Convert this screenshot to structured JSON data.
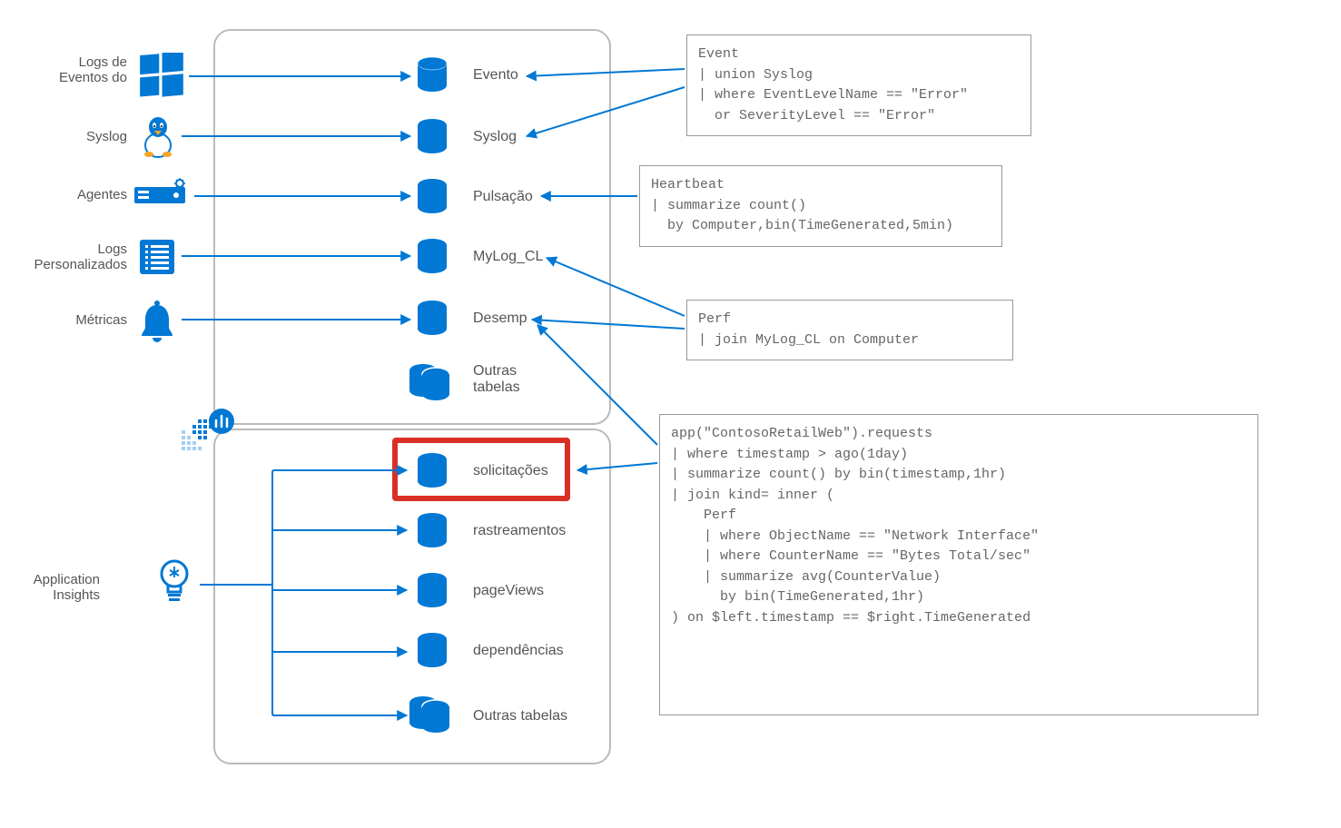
{
  "sources": [
    {
      "label": "Logs de\nEventos do"
    },
    {
      "label": "Syslog"
    },
    {
      "label": "Agentes"
    },
    {
      "label": "Logs\nPersonalizados"
    },
    {
      "label": "Métricas"
    },
    {
      "label": "Application\nInsights"
    }
  ],
  "tables_top": [
    {
      "label": "Evento"
    },
    {
      "label": "Syslog"
    },
    {
      "label": "Pulsação"
    },
    {
      "label": "MyLog_CL"
    },
    {
      "label": "Desemp"
    },
    {
      "label": "Outras\ntabelas"
    }
  ],
  "tables_bottom": [
    {
      "label": "solicitações"
    },
    {
      "label": "rastreamentos"
    },
    {
      "label": "pageViews"
    },
    {
      "label": "dependências"
    },
    {
      "label": "Outras tabelas"
    }
  ],
  "queries": {
    "q1": "Event\n| union Syslog\n| where EventLevelName == \"Error\"\n  or SeverityLevel == \"Error\"",
    "q2": "Heartbeat\n| summarize count()\n  by Computer,bin(TimeGenerated,5min)",
    "q3": "Perf\n| join MyLog_CL on Computer",
    "q4": "app(\"ContosoRetailWeb\").requests\n| where timestamp > ago(1day)\n| summarize count() by bin(timestamp,1hr)\n| join kind= inner (\n    Perf\n    | where ObjectName == \"Network Interface\"\n    | where CounterName == \"Bytes Total/sec\"\n    | summarize avg(CounterValue)\n      by bin(TimeGenerated,1hr)\n) on $left.timestamp == $right.TimeGenerated"
  }
}
